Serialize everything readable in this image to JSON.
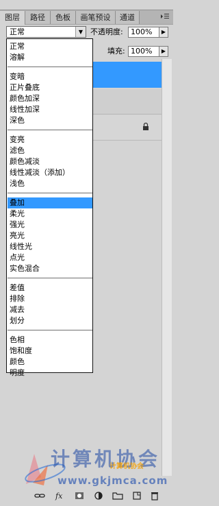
{
  "tabs": [
    {
      "label": "图层",
      "active": true
    },
    {
      "label": "路径",
      "active": false
    },
    {
      "label": "色板",
      "active": false
    },
    {
      "label": "画笔预设",
      "active": false
    },
    {
      "label": "通道",
      "active": false
    }
  ],
  "blend": {
    "current": "正常",
    "opacity_label": "不透明度:",
    "opacity_value": "100%",
    "fill_label": "填充:",
    "fill_value": "100%"
  },
  "dropdown": {
    "groups": [
      [
        "正常",
        "溶解"
      ],
      [
        "变暗",
        "正片叠底",
        "颜色加深",
        "线性加深",
        "深色"
      ],
      [
        "变亮",
        "滤色",
        "颜色减淡",
        "线性减淡（添加）",
        "浅色"
      ],
      [
        "叠加",
        "柔光",
        "强光",
        "亮光",
        "线性光",
        "点光",
        "实色混合"
      ],
      [
        "差值",
        "排除",
        "减去",
        "划分"
      ],
      [
        "色相",
        "饱和度",
        "颜色",
        "明度"
      ]
    ],
    "selected": "叠加"
  },
  "watermark": {
    "title": "计算机协会",
    "url": "www.gkjmca.com",
    "badge": "计算机协会"
  },
  "colors": {
    "selection": "#3399ff",
    "panel_bg": "#d4d4d4",
    "tab_bar": "#b4b4b4"
  }
}
